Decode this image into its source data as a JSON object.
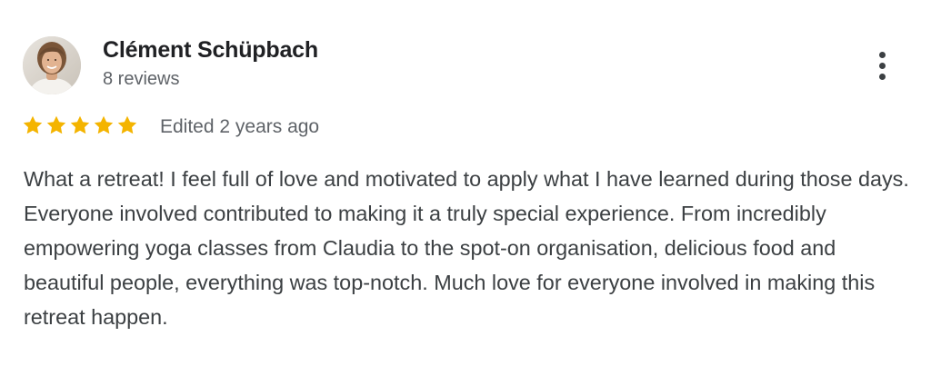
{
  "review": {
    "author": {
      "name": "Clément Schüpbach",
      "review_count": "8 reviews",
      "avatar": "profile-photo"
    },
    "rating": {
      "stars": 5,
      "max_stars": 5,
      "star_color": "#F4B400"
    },
    "edited_label": "Edited 2 years ago",
    "text": "What a retreat! I feel full of love and motivated to apply what I have learned during those days. Everyone involved contributed to making it a truly special experience. From incredibly empowering yoga classes from Claudia to the spot-on organisation, delicious food and beautiful people, everything was top-notch. Much love for everyone involved in making this retreat happen.",
    "menu_icon": "more-vert-icon"
  }
}
